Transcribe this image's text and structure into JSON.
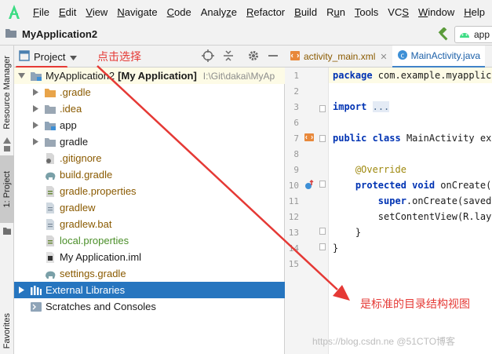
{
  "menu": [
    "File",
    "Edit",
    "View",
    "Navigate",
    "Code",
    "Analyze",
    "Refactor",
    "Build",
    "Run",
    "Tools",
    "VCS",
    "Window",
    "Help"
  ],
  "menu_mnemonics": [
    "F",
    "E",
    "V",
    "N",
    "C",
    "z",
    "R",
    "B",
    "u",
    "T",
    "S",
    "W",
    "H"
  ],
  "navbar": {
    "project_title": "MyApplication2",
    "run_config": "app"
  },
  "left_strip": {
    "resource_manager": "Resource Manager",
    "project_tab": "1: Project",
    "favorites": "Favorites"
  },
  "project_panel": {
    "view_label": "Project",
    "hint": "点击选择",
    "tree": [
      {
        "label": "MyApplication2",
        "suffix": "[My Application]",
        "path": "I:\\Git\\dakai\\MyAp",
        "icon": "module-folder-icon",
        "color": "#1a1a1a"
      },
      {
        "label": ".gradle",
        "icon": "folder-orange-icon",
        "color": "#8a5a00"
      },
      {
        "label": ".idea",
        "icon": "folder-grey-icon",
        "color": "#8a5a00"
      },
      {
        "label": "app",
        "icon": "module-folder-icon",
        "color": "#1a1a1a"
      },
      {
        "label": "gradle",
        "icon": "folder-grey-icon",
        "color": "#1a1a1a"
      },
      {
        "label": ".gitignore",
        "icon": "gitignore-file-icon",
        "color": "#8a5a00"
      },
      {
        "label": "build.gradle",
        "icon": "gradle-elephant-icon",
        "color": "#8a5a00"
      },
      {
        "label": "gradle.properties",
        "icon": "properties-file-icon",
        "color": "#8a5a00"
      },
      {
        "label": "gradlew",
        "icon": "text-file-icon",
        "color": "#8a5a00"
      },
      {
        "label": "gradlew.bat",
        "icon": "text-file-icon",
        "color": "#8a5a00"
      },
      {
        "label": "local.properties",
        "icon": "properties-file-icon",
        "color": "#4b8f29"
      },
      {
        "label": "My Application.iml",
        "icon": "iml-file-icon",
        "color": "#1a1a1a"
      },
      {
        "label": "settings.gradle",
        "icon": "gradle-elephant-icon",
        "color": "#8a5a00"
      },
      {
        "label": "External Libraries",
        "icon": "library-icon",
        "color": "#ffffff"
      },
      {
        "label": "Scratches and Consoles",
        "icon": "scratches-icon",
        "color": "#1a1a1a"
      }
    ]
  },
  "editor": {
    "tabs": [
      {
        "label": "activity_main.xml",
        "icon": "xml-file-icon"
      },
      {
        "label": "MainActivity.java",
        "icon": "java-class-icon"
      }
    ],
    "line_numbers": [
      "1",
      "2",
      "3",
      "6",
      "7",
      "8",
      "9",
      "10",
      "11",
      "12",
      "13",
      "14",
      "15"
    ],
    "code": {
      "l1_kw": "package",
      "l1_rest": " com.example.myapplica",
      "l3_kw": "import",
      "l3_fold": "...",
      "l7_kw1": "public",
      "l7_kw2": "class",
      "l7_rest": " MainActivity ext",
      "l9_ann": "@Override",
      "l10_kw1": "protected",
      "l10_kw2": "void",
      "l10_rest": " onCreate(B",
      "l11_kw": "super",
      "l11_rest": ".onCreate(savedI",
      "l12_rest": "setContentView(R.layo",
      "l13_rest": "}",
      "l14_rest": "}"
    }
  },
  "annotation": "是标准的目录结构视图",
  "watermark": "https://blog.csdn.ne  @51CTO博客",
  "colors": {
    "annotation_red": "#e53935",
    "selection_blue": "#2675bf",
    "accent_green": "#3ddc84"
  }
}
